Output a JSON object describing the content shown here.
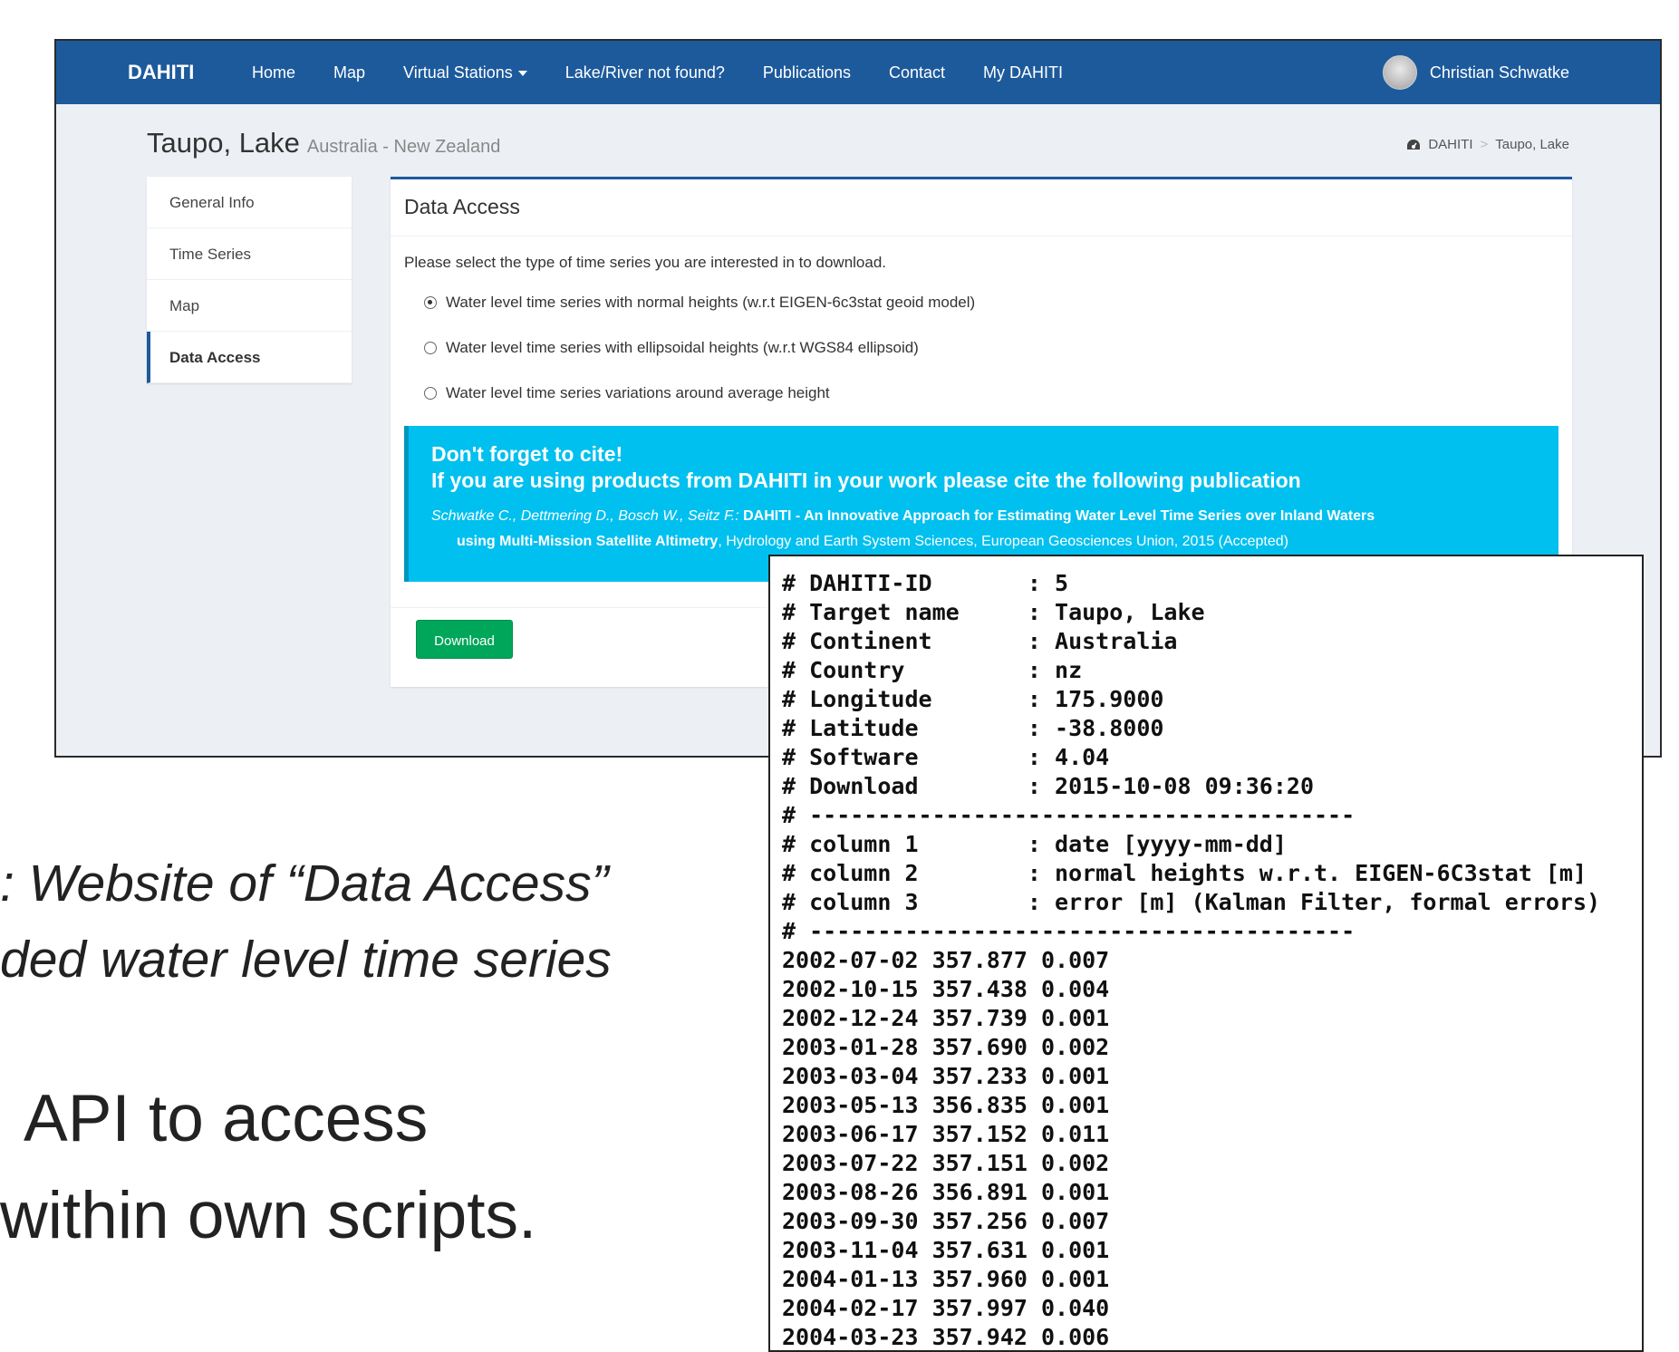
{
  "navbar": {
    "brand": "DAHITI",
    "items": [
      "Home",
      "Map",
      "Virtual Stations",
      "Lake/River not found?",
      "Publications",
      "Contact",
      "My DAHITI"
    ],
    "user_name": "Christian Schwatke"
  },
  "header": {
    "title": "Taupo, Lake",
    "subtitle": "Australia - New Zealand",
    "breadcrumb": [
      "DAHITI",
      "Taupo, Lake"
    ]
  },
  "sidebar": {
    "items": [
      "General Info",
      "Time Series",
      "Map",
      "Data Access"
    ],
    "active": "Data Access"
  },
  "panel": {
    "title": "Data Access",
    "intro": "Please select the type of time series you are interested in to download.",
    "options": [
      "Water level time series with normal heights (w.r.t EIGEN-6c3stat geoid model)",
      "Water level time series with ellipsoidal heights (w.r.t WGS84 ellipsoid)",
      "Water level time series variations around average height"
    ],
    "selected_option": 0,
    "callout": {
      "heading1": "Don't forget to cite!",
      "heading2": "If you are using products from DAHITI in your work please cite the following publication",
      "authors": "Schwatke C., Dettmering D., Bosch W., Seitz F.:",
      "title_part1": "DAHITI - An Innovative Approach for Estimating Water Level Time Series over Inland Waters",
      "title_part2": "using Multi-Mission Satellite Altimetry",
      "journal": ", Hydrology and Earth System Sciences, European Geosciences Union, 2015 (Accepted)"
    },
    "download_label": "Download"
  },
  "caption": {
    "line1": ": Website of “Data Access”",
    "line2": "ded water level time series"
  },
  "body_text": {
    "line1": "API to access",
    "line2": "within own scripts."
  },
  "terminal": {
    "lines": [
      "# DAHITI-ID       : 5",
      "# Target name     : Taupo, Lake",
      "# Continent       : Australia",
      "# Country         : nz",
      "# Longitude       : 175.9000",
      "# Latitude        : -38.8000",
      "# Software        : 4.04",
      "# Download        : 2015-10-08 09:36:20",
      "# ----------------------------------------",
      "# column 1        : date [yyyy-mm-dd]",
      "# column 2        : normal heights w.r.t. EIGEN-6C3stat [m]",
      "# column 3        : error [m] (Kalman Filter, formal errors)",
      "# ----------------------------------------",
      "2002-07-02 357.877 0.007",
      "2002-10-15 357.438 0.004",
      "2002-12-24 357.739 0.001",
      "2003-01-28 357.690 0.002",
      "2003-03-04 357.233 0.001",
      "2003-05-13 356.835 0.001",
      "2003-06-17 357.152 0.011",
      "2003-07-22 357.151 0.002",
      "2003-08-26 356.891 0.001",
      "2003-09-30 357.256 0.007",
      "2003-11-04 357.631 0.001",
      "2004-01-13 357.960 0.001",
      "2004-02-17 357.997 0.040",
      "2004-03-23 357.942 0.006"
    ]
  },
  "colors": {
    "navbar": "#1d5a9c",
    "callout": "#00c0ef",
    "download": "#00a65a",
    "page_bg": "#ecf0f5"
  }
}
